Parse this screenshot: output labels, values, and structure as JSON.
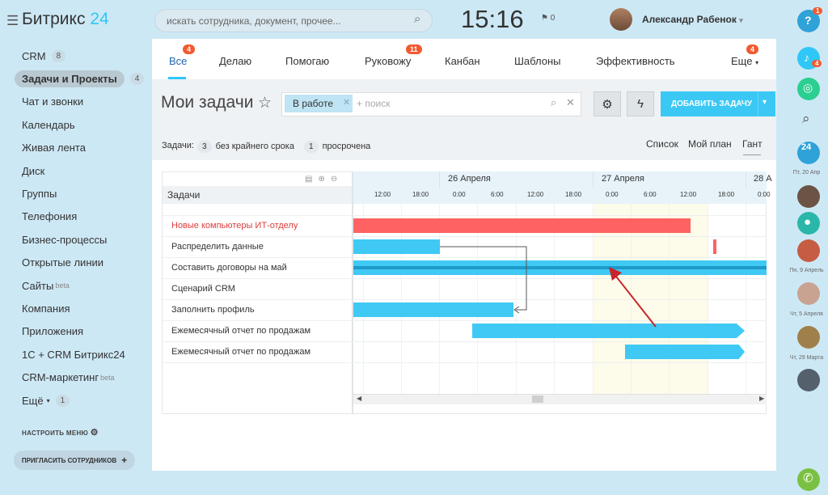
{
  "app": {
    "brand_name": "Битрикс",
    "brand_version": "24"
  },
  "search": {
    "placeholder": "искать сотрудника, документ, прочее..."
  },
  "clock": {
    "time": "15:16",
    "flag_count": "0"
  },
  "user": {
    "name": "Александр Рабенок"
  },
  "sidebar": {
    "items": [
      {
        "label": "CRM",
        "count": "8"
      },
      {
        "label": "Задачи и Проекты",
        "count": "4"
      },
      {
        "label": "Чат и звонки"
      },
      {
        "label": "Календарь"
      },
      {
        "label": "Живая лента"
      },
      {
        "label": "Диск"
      },
      {
        "label": "Группы"
      },
      {
        "label": "Телефония"
      },
      {
        "label": "Бизнес-процессы"
      },
      {
        "label": "Открытые линии"
      },
      {
        "label": "Сайты",
        "sup": "beta"
      },
      {
        "label": "Компания"
      },
      {
        "label": "Приложения"
      },
      {
        "label": "1С + CRM Битрикс24"
      },
      {
        "label": "CRM-маркетинг",
        "sup": "beta"
      },
      {
        "label": "Ещё",
        "count": "1"
      }
    ],
    "configure_menu": "НАСТРОИТЬ МЕНЮ",
    "invite": "ПРИГЛАСИТЬ СОТРУДНИКОВ"
  },
  "tabs": [
    {
      "label": "Все",
      "badge": "4"
    },
    {
      "label": "Делаю"
    },
    {
      "label": "Помогаю"
    },
    {
      "label": "Руковожу",
      "badge": "11"
    },
    {
      "label": "Канбан"
    },
    {
      "label": "Шаблоны"
    },
    {
      "label": "Эффективность"
    },
    {
      "label": "Еще",
      "badge": "4"
    }
  ],
  "toolbar": {
    "title": "Мои задачи",
    "filter_chip": "В работе",
    "filter_placeholder": "+ поиск",
    "add_task": "ДОБАВИТЬ ЗАДАЧУ"
  },
  "stats": {
    "prefix": "Задачи:",
    "no_deadline_count": "3",
    "no_deadline_label": "без крайнего срока",
    "overdue_count": "1",
    "overdue_label": "просрочена"
  },
  "views": {
    "list": "Список",
    "plan": "Мой план",
    "gantt": "Гант"
  },
  "gantt": {
    "header": "Задачи",
    "days": [
      "26 Апреля",
      "27 Апреля",
      "28 А"
    ],
    "hours": [
      "12:00",
      "18:00",
      "0:00",
      "6:00",
      "12:00",
      "18:00",
      "0:00",
      "6:00",
      "12:00",
      "18:00",
      "0:00"
    ],
    "tasks": [
      "Новые компьютеры ИТ-отделу",
      "Распределить данные",
      "Составить договоры на май",
      "Сценарий CRM",
      "Заполнить профиль",
      "Ежемесячный отчет по продажам",
      "Ежемесячный отчет по продажам"
    ]
  },
  "right_bar": {
    "help_badge": "1",
    "notifications_badge": "4",
    "calendar_day": "24",
    "dates": [
      "Пт, 20 Апр",
      "Пн, 9 Апрель",
      "Чт, 5 Апреля",
      "Чт, 29 Марта"
    ]
  },
  "colors": {
    "accent": "#3bc8f5",
    "badge": "#f25a2f",
    "overdue_bar": "#ff6262",
    "phone": "#7ac143"
  }
}
